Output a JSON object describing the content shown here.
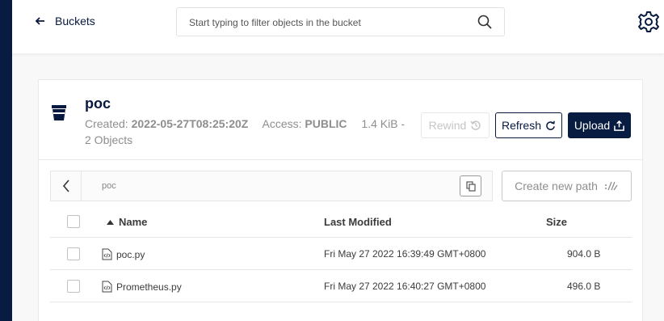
{
  "topbar": {
    "back_label": "Buckets",
    "search_placeholder": "Start typing to filter objects in the bucket"
  },
  "bucket": {
    "name": "poc",
    "created_label": "Created:",
    "created_value": "2022-05-27T08:25:20Z",
    "access_label": "Access:",
    "access_value": "PUBLIC",
    "size_objects_1": "1.4 KiB -",
    "size_objects_2": "2 Objects"
  },
  "actions": {
    "rewind_label": "Rewind",
    "refresh_label": "Refresh",
    "upload_label": "Upload"
  },
  "path": {
    "current": "poc",
    "create_new_path_label": "Create new path"
  },
  "table": {
    "headers": {
      "name": "Name",
      "last_modified": "Last Modified",
      "size": "Size"
    },
    "rows": [
      {
        "name": "poc.py",
        "last_modified": "Fri May 27 2022 16:39:49 GMT+0800",
        "size": "904.0 B"
      },
      {
        "name": "Prometheus.py",
        "last_modified": "Fri May 27 2022 16:40:27 GMT+0800",
        "size": "496.0 B"
      }
    ]
  },
  "colors": {
    "brand_dark": "#081c42",
    "muted": "#8e8e8e",
    "border": "#e5e5e5"
  }
}
